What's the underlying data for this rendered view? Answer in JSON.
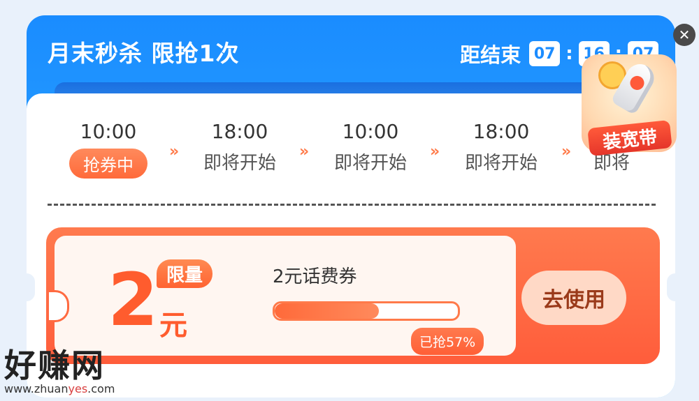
{
  "header": {
    "title": "月末秒杀  限抢1次",
    "countdown_label": "距结束",
    "hours": "07",
    "minutes": "16",
    "seconds": "07"
  },
  "schedule": [
    {
      "time": "10:00",
      "status": "抢券中",
      "active": true
    },
    {
      "time": "18:00",
      "status": "即将开始",
      "active": false
    },
    {
      "time": "10:00",
      "status": "即将开始",
      "active": false
    },
    {
      "time": "18:00",
      "status": "即将开始",
      "active": false
    },
    {
      "time": "",
      "status": "即将",
      "active": false
    }
  ],
  "coupon": {
    "amount": "2",
    "unit": "元",
    "limit_tag": "限量",
    "name": "2元话费券",
    "progress": 0.57,
    "grabbed_text": "已抢57%",
    "button_label": "去使用"
  },
  "promo_badge": {
    "label": "装宽带"
  },
  "watermark": {
    "main": "好赚网",
    "url_prefix": "www.zhuan",
    "url_highlight": "yes",
    "url_suffix": ".com"
  },
  "colors": {
    "header_blue": "#1a8cff",
    "accent_orange": "#ff6a3a"
  }
}
